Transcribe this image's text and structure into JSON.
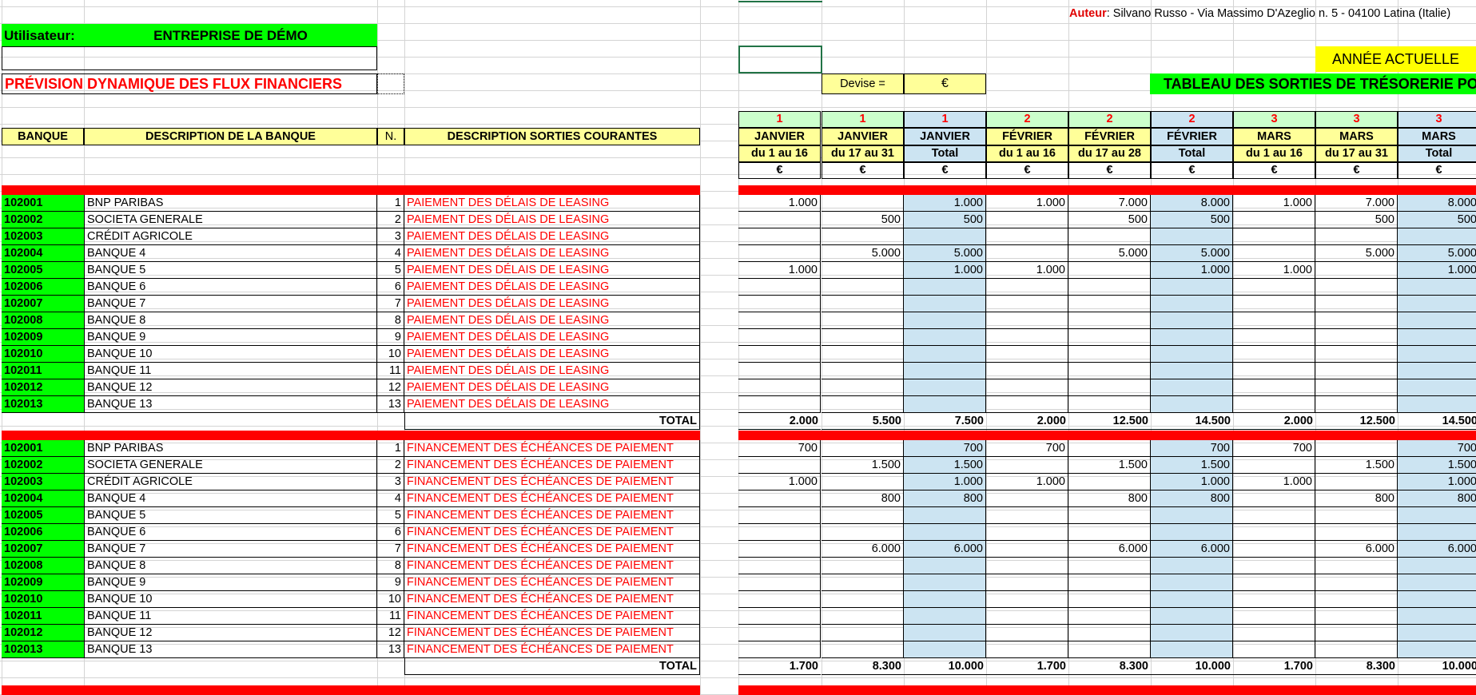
{
  "author_label": "Auteur",
  "author_text": ": Silvano Russo - Via Massimo D'Azeglio n. 5 - 04100 Latina (Italie)",
  "user_label": "Utilisateur:",
  "company": "ENTREPRISE DE DÉMO",
  "report_title": "PRÉVISION DYNAMIQUE DES FLUX FINANCIERS",
  "currency_label": "Devise =",
  "currency_symbol": "€",
  "current_year_label": "ANNÉE ACTUELLE",
  "table_title": "TABLEAU DES SORTIES DE TRÉSORERIE PO",
  "headers": {
    "bank": "BANQUE",
    "bank_desc": "DESCRIPTION DE LA BANQUE",
    "num": "N.",
    "outflow_desc": "DESCRIPTION SORTIES COURANTES"
  },
  "periods": [
    {
      "month_num": "1",
      "month": "JANVIER",
      "range": "du 1 au 16",
      "unit": "€"
    },
    {
      "month_num": "1",
      "month": "JANVIER",
      "range": "du 17 au 31",
      "unit": "€"
    },
    {
      "month_num": "1",
      "month": "JANVIER",
      "range": "Total",
      "unit": "€"
    },
    {
      "month_num": "2",
      "month": "FÉVRIER",
      "range": "du 1 au 16",
      "unit": "€"
    },
    {
      "month_num": "2",
      "month": "FÉVRIER",
      "range": "du 17 au 28",
      "unit": "€"
    },
    {
      "month_num": "2",
      "month": "FÉVRIER",
      "range": "Total",
      "unit": "€"
    },
    {
      "month_num": "3",
      "month": "MARS",
      "range": "du 1 au 16",
      "unit": "€"
    },
    {
      "month_num": "3",
      "month": "MARS",
      "range": "du 17 au 31",
      "unit": "€"
    },
    {
      "month_num": "3",
      "month": "MARS",
      "range": "Total",
      "unit": "€"
    }
  ],
  "sections": [
    {
      "description": "PAIEMENT DES DÉLAIS DE LEASING",
      "rows": [
        {
          "code": "102001",
          "bank": "BNP PARIBAS",
          "n": "1",
          "values": [
            "1.000",
            "",
            "1.000",
            "1.000",
            "7.000",
            "8.000",
            "1.000",
            "7.000",
            "8.000"
          ]
        },
        {
          "code": "102002",
          "bank": "SOCIETA GENERALE",
          "n": "2",
          "values": [
            "",
            "500",
            "500",
            "",
            "500",
            "500",
            "",
            "500",
            "500"
          ]
        },
        {
          "code": "102003",
          "bank": "CRÉDIT AGRICOLE",
          "n": "3",
          "values": [
            "",
            "",
            "",
            "",
            "",
            "",
            "",
            "",
            ""
          ]
        },
        {
          "code": "102004",
          "bank": "BANQUE 4",
          "n": "4",
          "values": [
            "",
            "5.000",
            "5.000",
            "",
            "5.000",
            "5.000",
            "",
            "5.000",
            "5.000"
          ]
        },
        {
          "code": "102005",
          "bank": "BANQUE 5",
          "n": "5",
          "values": [
            "1.000",
            "",
            "1.000",
            "1.000",
            "",
            "1.000",
            "1.000",
            "",
            "1.000"
          ]
        },
        {
          "code": "102006",
          "bank": "BANQUE 6",
          "n": "6",
          "values": [
            "",
            "",
            "",
            "",
            "",
            "",
            "",
            "",
            ""
          ]
        },
        {
          "code": "102007",
          "bank": "BANQUE 7",
          "n": "7",
          "values": [
            "",
            "",
            "",
            "",
            "",
            "",
            "",
            "",
            ""
          ]
        },
        {
          "code": "102008",
          "bank": "BANQUE 8",
          "n": "8",
          "values": [
            "",
            "",
            "",
            "",
            "",
            "",
            "",
            "",
            ""
          ]
        },
        {
          "code": "102009",
          "bank": "BANQUE 9",
          "n": "9",
          "values": [
            "",
            "",
            "",
            "",
            "",
            "",
            "",
            "",
            ""
          ]
        },
        {
          "code": "102010",
          "bank": "BANQUE 10",
          "n": "10",
          "values": [
            "",
            "",
            "",
            "",
            "",
            "",
            "",
            "",
            ""
          ]
        },
        {
          "code": "102011",
          "bank": "BANQUE 11",
          "n": "11",
          "values": [
            "",
            "",
            "",
            "",
            "",
            "",
            "",
            "",
            ""
          ]
        },
        {
          "code": "102012",
          "bank": "BANQUE 12",
          "n": "12",
          "values": [
            "",
            "",
            "",
            "",
            "",
            "",
            "",
            "",
            ""
          ]
        },
        {
          "code": "102013",
          "bank": "BANQUE 13",
          "n": "13",
          "values": [
            "",
            "",
            "",
            "",
            "",
            "",
            "",
            "",
            ""
          ]
        }
      ],
      "total_label": "TOTAL",
      "totals": [
        "2.000",
        "5.500",
        "7.500",
        "2.000",
        "12.500",
        "14.500",
        "2.000",
        "12.500",
        "14.500"
      ]
    },
    {
      "description": "FINANCEMENT DES ÉCHÉANCES DE PAIEMENT",
      "rows": [
        {
          "code": "102001",
          "bank": "BNP PARIBAS",
          "n": "1",
          "values": [
            "700",
            "",
            "700",
            "700",
            "",
            "700",
            "700",
            "",
            "700"
          ]
        },
        {
          "code": "102002",
          "bank": "SOCIETA GENERALE",
          "n": "2",
          "values": [
            "",
            "1.500",
            "1.500",
            "",
            "1.500",
            "1.500",
            "",
            "1.500",
            "1.500"
          ]
        },
        {
          "code": "102003",
          "bank": "CRÉDIT AGRICOLE",
          "n": "3",
          "values": [
            "1.000",
            "",
            "1.000",
            "1.000",
            "",
            "1.000",
            "1.000",
            "",
            "1.000"
          ]
        },
        {
          "code": "102004",
          "bank": "BANQUE 4",
          "n": "4",
          "values": [
            "",
            "800",
            "800",
            "",
            "800",
            "800",
            "",
            "800",
            "800"
          ]
        },
        {
          "code": "102005",
          "bank": "BANQUE 5",
          "n": "5",
          "values": [
            "",
            "",
            "",
            "",
            "",
            "",
            "",
            "",
            ""
          ]
        },
        {
          "code": "102006",
          "bank": "BANQUE 6",
          "n": "6",
          "values": [
            "",
            "",
            "",
            "",
            "",
            "",
            "",
            "",
            ""
          ]
        },
        {
          "code": "102007",
          "bank": "BANQUE 7",
          "n": "7",
          "values": [
            "",
            "6.000",
            "6.000",
            "",
            "6.000",
            "6.000",
            "",
            "6.000",
            "6.000"
          ]
        },
        {
          "code": "102008",
          "bank": "BANQUE 8",
          "n": "8",
          "values": [
            "",
            "",
            "",
            "",
            "",
            "",
            "",
            "",
            ""
          ]
        },
        {
          "code": "102009",
          "bank": "BANQUE 9",
          "n": "9",
          "values": [
            "",
            "",
            "",
            "",
            "",
            "",
            "",
            "",
            ""
          ]
        },
        {
          "code": "102010",
          "bank": "BANQUE 10",
          "n": "10",
          "values": [
            "",
            "",
            "",
            "",
            "",
            "",
            "",
            "",
            ""
          ]
        },
        {
          "code": "102011",
          "bank": "BANQUE 11",
          "n": "11",
          "values": [
            "",
            "",
            "",
            "",
            "",
            "",
            "",
            "",
            ""
          ]
        },
        {
          "code": "102012",
          "bank": "BANQUE 12",
          "n": "12",
          "values": [
            "",
            "",
            "",
            "",
            "",
            "",
            "",
            "",
            ""
          ]
        },
        {
          "code": "102013",
          "bank": "BANQUE 13",
          "n": "13",
          "values": [
            "",
            "",
            "",
            "",
            "",
            "",
            "",
            "",
            ""
          ]
        }
      ],
      "total_label": "TOTAL",
      "totals": [
        "1.700",
        "8.300",
        "10.000",
        "1.700",
        "8.300",
        "10.000",
        "1.700",
        "8.300",
        "10.000"
      ]
    }
  ],
  "colors": {
    "green": "#00ff00",
    "yellow": "#ffff99",
    "bright_yellow": "#ffff00",
    "light_green": "#ccffcc",
    "light_blue": "#cce4f2",
    "red": "#ff0000",
    "selection": "#217346"
  }
}
